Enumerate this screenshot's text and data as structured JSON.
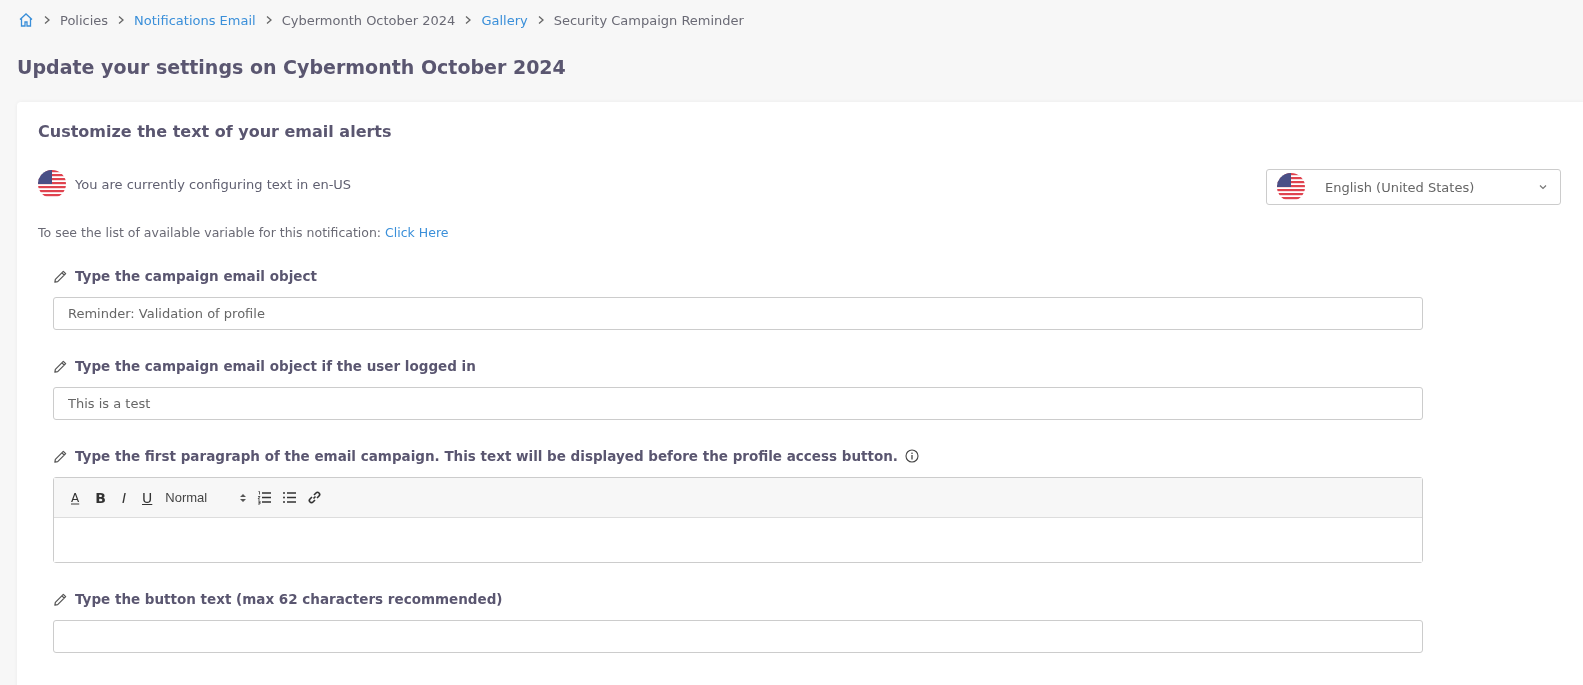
{
  "breadcrumbs": [
    {
      "label": "Policies",
      "kind": "text"
    },
    {
      "label": "Notifications Email",
      "kind": "link"
    },
    {
      "label": "Cybermonth October 2024",
      "kind": "text"
    },
    {
      "label": "Gallery",
      "kind": "link"
    },
    {
      "label": "Security Campaign Reminder",
      "kind": "text"
    }
  ],
  "page_title": "Update your settings on Cybermonth October 2024",
  "card": {
    "title": "Customize the text of your email alerts",
    "locale_note": "You are currently configuring text in en-US",
    "language_select": {
      "value": "English (United States)"
    },
    "variables_note": "To see the list of available variable for this notification:",
    "variables_link": "Click Here",
    "fields": [
      {
        "kind": "input",
        "label": "Type the campaign email object",
        "value": "Reminder: Validation of profile"
      },
      {
        "kind": "input",
        "label": "Type the campaign email object if the user logged in",
        "value": "This is a test"
      },
      {
        "kind": "rich",
        "label": "Type the first paragraph of the email campaign. This text will be displayed before the profile access button.",
        "info": true,
        "toolbar": [
          {
            "kind": "color",
            "label": "A"
          },
          {
            "kind": "bold",
            "label": "B"
          },
          {
            "kind": "italic",
            "label": "I"
          },
          {
            "kind": "underline",
            "label": "U"
          }
        ],
        "format": "Normal"
      },
      {
        "kind": "input",
        "label": "Type the button text (max 62 characters recommended)"
      }
    ]
  }
}
